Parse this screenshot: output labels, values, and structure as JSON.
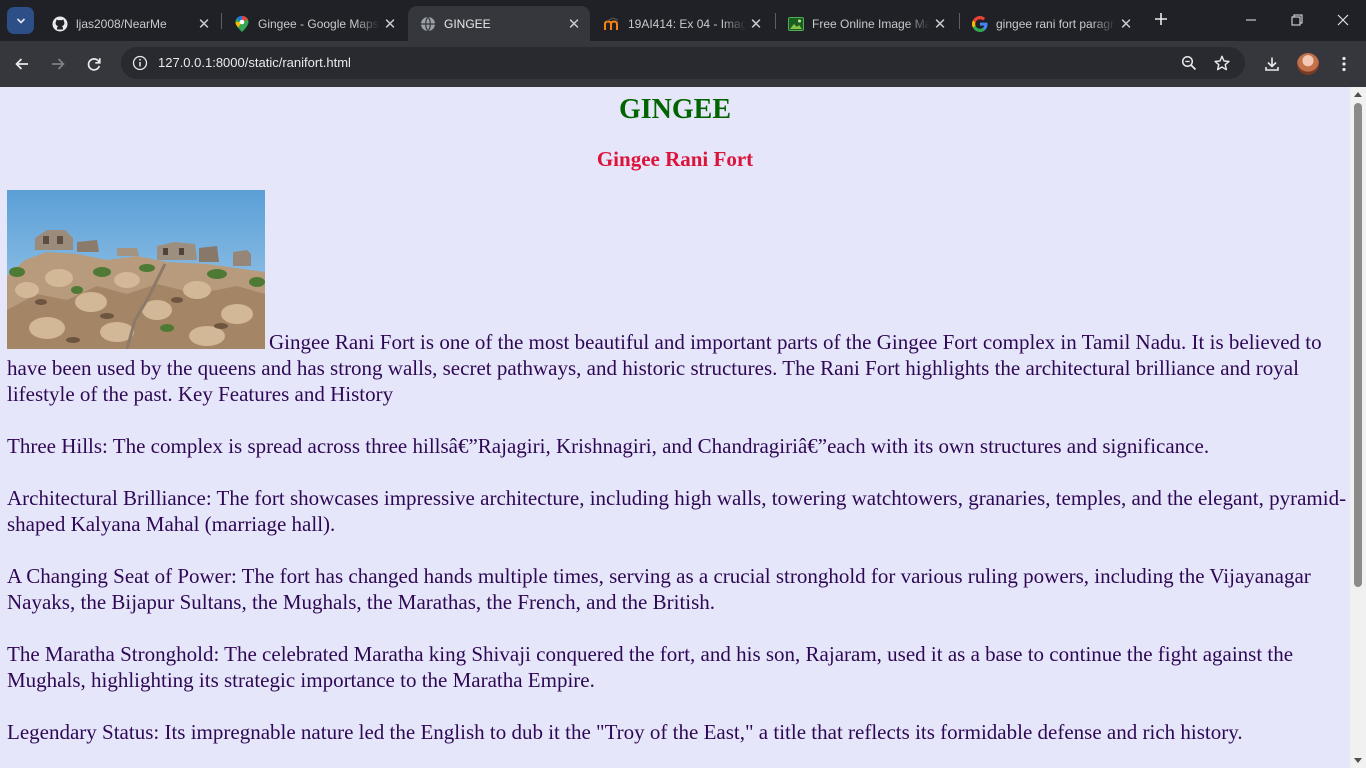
{
  "browser": {
    "tabs": [
      {
        "title": "ljas2008/NearMe",
        "icon": "github-icon",
        "active": false
      },
      {
        "title": "Gingee - Google Maps",
        "icon": "google-maps-icon",
        "active": false
      },
      {
        "title": "GINGEE",
        "icon": "globe-icon",
        "active": true
      },
      {
        "title": "19AI414: Ex 04 - Image",
        "icon": "moodle-icon",
        "active": false
      },
      {
        "title": "Free Online Image Maker",
        "icon": "image-icon",
        "active": false
      },
      {
        "title": "gingee rani fort paragraph",
        "icon": "google-icon",
        "active": false
      }
    ],
    "url": "127.0.0.1:8000/static/ranifort.html"
  },
  "page": {
    "heading": "GINGEE",
    "subheading": "Gingee Rani Fort",
    "image_alt": "Gingee Rani Fort",
    "paragraphs": [
      "Gingee Rani Fort is one of the most beautiful and important parts of the Gingee Fort complex in Tamil Nadu. It is believed to have been used by the queens and has strong walls, secret pathways, and historic structures. The Rani Fort highlights the architectural brilliance and royal lifestyle of the past. Key Features and History",
      "Three Hills: The complex is spread across three hillsâ€”Rajagiri, Krishnagiri, and Chandragiriâ€”each with its own structures and significance.",
      "Architectural Brilliance: The fort showcases impressive architecture, including high walls, towering watchtowers, granaries, temples, and the elegant, pyramid-shaped Kalyana Mahal (marriage hall).",
      "A Changing Seat of Power: The fort has changed hands multiple times, serving as a crucial stronghold for various ruling powers, including the Vijayanagar Nayaks, the Bijapur Sultans, the Mughals, the Marathas, the French, and the British.",
      "The Maratha Stronghold: The celebrated Maratha king Shivaji conquered the fort, and his son, Rajaram, used it as a base to continue the fight against the Mughals, highlighting its strategic importance to the Maratha Empire.",
      "Legendary Status: Its impregnable nature led the English to dub it the \"Troy of the East,\" a title that reflects its formidable defense and rich history."
    ]
  },
  "colors": {
    "page_bg": "#e6e6fa",
    "heading": "#006400",
    "subheading": "#dc143c",
    "text": "#2e0854"
  }
}
